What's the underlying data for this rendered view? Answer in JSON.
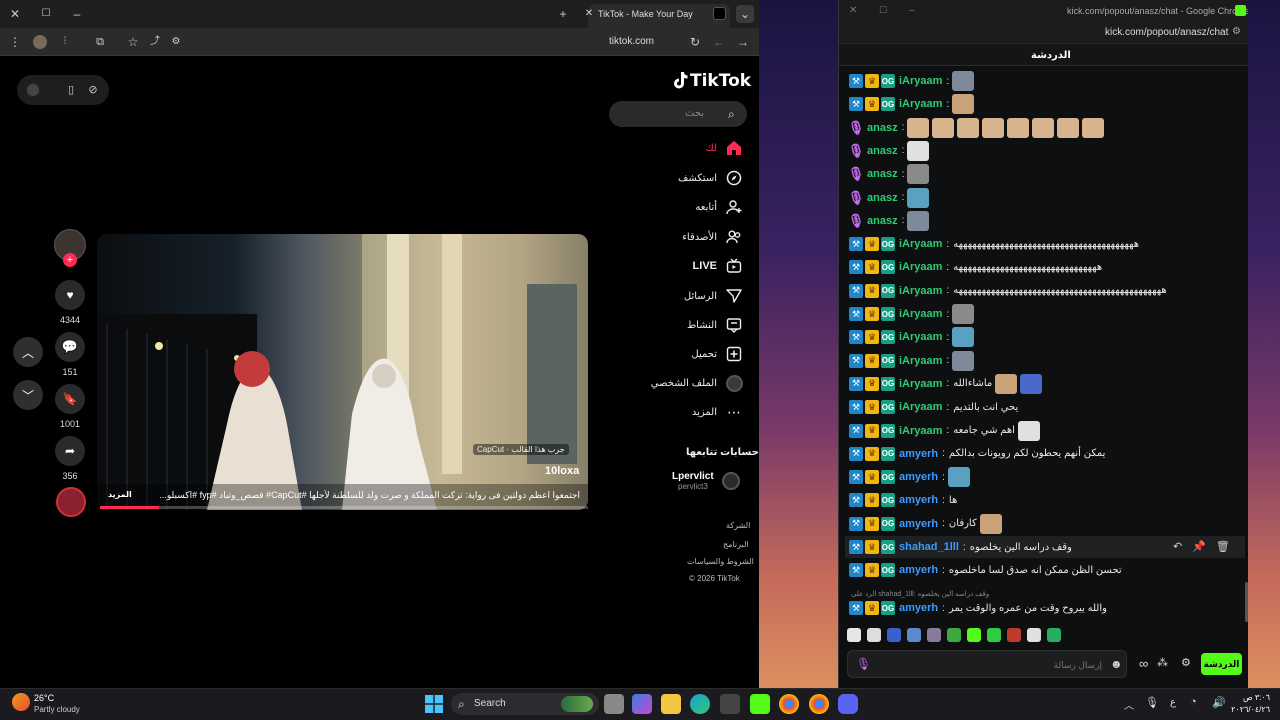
{
  "browser_left": {
    "tab_title": "TikTok - Make Your Day",
    "url": "tiktok.com"
  },
  "tiktok": {
    "logo": "TikTok",
    "search_placeholder": "بحث",
    "nav": [
      {
        "label": "لك",
        "icon": "home-icon"
      },
      {
        "label": "استكشف",
        "icon": "compass-icon"
      },
      {
        "label": "أتابعه",
        "icon": "user-follow-icon"
      },
      {
        "label": "الأصدقاء",
        "icon": "friends-icon"
      },
      {
        "label": "LIVE",
        "icon": "live-icon"
      },
      {
        "label": "الرسائل",
        "icon": "send-icon"
      },
      {
        "label": "النشاط",
        "icon": "inbox-icon"
      },
      {
        "label": "تحميل",
        "icon": "upload-icon"
      },
      {
        "label": "الملف الشخصي",
        "icon": "profile-avatar-icon"
      },
      {
        "label": "المزيد",
        "icon": "more-icon"
      }
    ],
    "following_header": "حسابات تتابعها",
    "following_account": {
      "name": "Lpervlict",
      "handle": "pervlict3"
    },
    "footer": [
      "الشركة",
      "البرنامج",
      "الشروط والسياسات",
      "© 2026 TikTok"
    ],
    "video": {
      "capcut_tag": "CapCut · جرب هذا القالب",
      "username": "10loxa",
      "caption": "اجتمعوا اعظم دولتين فى رواية: تركت المملكة و صرت ولد للسلطنة لأجلها #CapCut# قصص_وتباد #fyp #اكسبلو...",
      "more": "المزيد",
      "progress": 0.12
    },
    "actions": {
      "likes": "4344",
      "comments": "151",
      "saves": "1001",
      "shares": "356"
    }
  },
  "browser_right": {
    "title": "kick.com/popout/anasz/chat - Google Chrome",
    "url": "kick.com/popout/anasz/chat"
  },
  "kick_chat": {
    "header": "الدردشة",
    "messages": [
      {
        "user": "iAryaam",
        "color": "#2ecc71",
        "badges": [
          "mod",
          "vip",
          "og"
        ],
        "text": "",
        "emotes": 1
      },
      {
        "user": "iAryaam",
        "color": "#2ecc71",
        "badges": [
          "mod",
          "vip",
          "og"
        ],
        "text": "",
        "emotes": 1
      },
      {
        "user": "anasz",
        "color": "#2ecc71",
        "badges": [
          "mic"
        ],
        "text": "",
        "emotes": 8
      },
      {
        "user": "anasz",
        "color": "#2ecc71",
        "badges": [
          "mic"
        ],
        "text": "",
        "emotes": 1
      },
      {
        "user": "anasz",
        "color": "#2ecc71",
        "badges": [
          "mic"
        ],
        "text": "",
        "emotes": 1
      },
      {
        "user": "anasz",
        "color": "#2ecc71",
        "badges": [
          "mic"
        ],
        "text": "",
        "emotes": 1
      },
      {
        "user": "anasz",
        "color": "#2ecc71",
        "badges": [
          "mic"
        ],
        "text": "",
        "emotes": 1
      },
      {
        "user": "iAryaam",
        "color": "#2ecc71",
        "badges": [
          "mod",
          "vip",
          "og"
        ],
        "text": "هههههههههههههههههههههههههههههههههههههههه",
        "emotes": 0
      },
      {
        "user": "iAryaam",
        "color": "#2ecc71",
        "badges": [
          "mod",
          "vip",
          "og"
        ],
        "text": "هههههههههههههههههههههههههههههههه",
        "emotes": 0
      },
      {
        "user": "iAryaam",
        "color": "#2ecc71",
        "badges": [
          "mod",
          "vip",
          "og"
        ],
        "text": "هههههههههههههههههههههههههههههههههههههههههههههه",
        "emotes": 0
      },
      {
        "user": "iAryaam",
        "color": "#2ecc71",
        "badges": [
          "mod",
          "vip",
          "og"
        ],
        "text": "",
        "emotes": 1
      },
      {
        "user": "iAryaam",
        "color": "#2ecc71",
        "badges": [
          "mod",
          "vip",
          "og"
        ],
        "text": "",
        "emotes": 1
      },
      {
        "user": "iAryaam",
        "color": "#2ecc71",
        "badges": [
          "mod",
          "vip",
          "og"
        ],
        "text": "",
        "emotes": 1
      },
      {
        "user": "iAryaam",
        "color": "#2ecc71",
        "badges": [
          "mod",
          "vip",
          "og"
        ],
        "text": "ماشاءالله",
        "emotes": 2
      },
      {
        "user": "iAryaam",
        "color": "#2ecc71",
        "badges": [
          "mod",
          "vip",
          "og"
        ],
        "text": "يحي انت بالتديم",
        "emotes": 0
      },
      {
        "user": "iAryaam",
        "color": "#2ecc71",
        "badges": [
          "mod",
          "vip",
          "og"
        ],
        "text": "اهم شي جامعه",
        "emotes": 1
      },
      {
        "user": "amyerh",
        "color": "#3b9bff",
        "badges": [
          "mod",
          "vip",
          "og"
        ],
        "text": "يمكن أنهم يحطون لكم رويونات بدالكم",
        "emotes": 0
      },
      {
        "user": "amyerh",
        "color": "#3b9bff",
        "badges": [
          "mod",
          "vip",
          "og"
        ],
        "text": "",
        "emotes": 1
      },
      {
        "user": "amyerh",
        "color": "#3b9bff",
        "badges": [
          "mod",
          "vip",
          "og"
        ],
        "text": "ها",
        "emotes": 0
      },
      {
        "user": "amyerh",
        "color": "#3b9bff",
        "badges": [
          "mod",
          "vip",
          "og"
        ],
        "text": "كارفان",
        "emotes": 1
      },
      {
        "user": "shahad_1lll",
        "color": "#3b9bff",
        "badges": [
          "mod",
          "vip",
          "og"
        ],
        "text": "وقف دراسه الين يخلصوه",
        "emotes": 0
      },
      {
        "user": "amyerh",
        "color": "#3b9bff",
        "badges": [
          "mod",
          "vip",
          "og"
        ],
        "text": "تحسن الظن ممكن انه صدق لسا ماخلصوه",
        "emotes": 0
      },
      {
        "user": "amyerh",
        "color": "#3b9bff",
        "badges": [
          "mod",
          "vip",
          "og"
        ],
        "text": "والله ييروح وقت من عمره والوقت يمر",
        "emotes": 0
      }
    ],
    "reply_note": "الرد على shahad_1lll: وقف دراسه الين يخلصوه",
    "input_placeholder": "إرسال رسالة",
    "send_label": "الدردشة",
    "accent": "#53fc18"
  },
  "taskbar": {
    "weather_temp": "26°C",
    "weather_desc": "Partly cloudy",
    "search_label": "Search",
    "time": "٣:٠٦ ص",
    "date": "٢٠٢٦/٠٤/٢٦"
  }
}
